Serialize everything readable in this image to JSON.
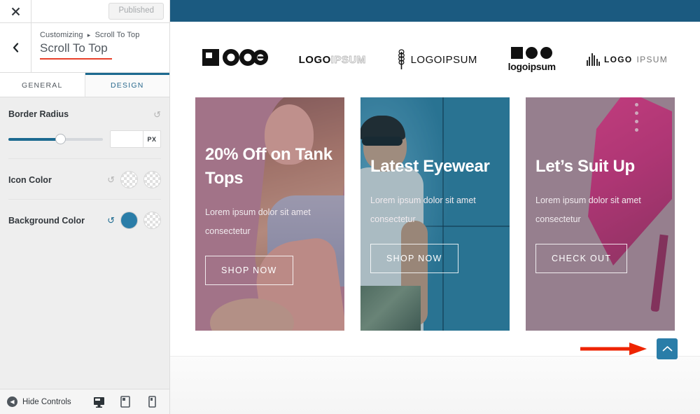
{
  "customizer": {
    "close_icon": "close-icon",
    "publish_button": "Published",
    "back_icon": "chevron-left-icon",
    "breadcrumb_root": "Customizing",
    "breadcrumb_sep": "▸",
    "breadcrumb_current": "Scroll To Top",
    "panel_title": "Scroll To Top",
    "tabs": [
      {
        "label": "GENERAL",
        "active": false
      },
      {
        "label": "DESIGN",
        "active": true
      }
    ],
    "controls": [
      {
        "label": "Border Radius",
        "type": "slider",
        "reset_icon": "reset-icon",
        "reset_active": false,
        "value": "",
        "placeholder": "",
        "unit": "PX",
        "fill_percent": 55
      },
      {
        "label": "Icon Color",
        "type": "color",
        "reset_icon": "reset-icon",
        "reset_active": false,
        "swatches": [
          {
            "name": "icon-color-swatch-primary",
            "kind": "transparent",
            "hex": ""
          },
          {
            "name": "icon-color-swatch-secondary",
            "kind": "transparent",
            "hex": ""
          }
        ]
      },
      {
        "label": "Background Color",
        "type": "color",
        "reset_icon": "reset-icon",
        "reset_active": true,
        "swatches": [
          {
            "name": "bg-color-swatch-primary",
            "kind": "filled",
            "hex": "#2a7da8"
          },
          {
            "name": "bg-color-swatch-secondary",
            "kind": "transparent",
            "hex": ""
          }
        ]
      }
    ],
    "footer": {
      "hide_controls_label": "Hide Controls",
      "hide_controls_icon": "caret-left-circle-icon",
      "devices": [
        {
          "name": "desktop-preview-button",
          "icon": "desktop-icon",
          "active": true
        },
        {
          "name": "tablet-preview-button",
          "icon": "tablet-icon",
          "active": false
        },
        {
          "name": "mobile-preview-button",
          "icon": "mobile-icon",
          "active": false
        }
      ]
    }
  },
  "preview": {
    "topband_color": "#1b5a80",
    "logos": [
      {
        "name": "logo-logo",
        "text": "LOGO"
      },
      {
        "name": "logo-logoipsum-outline",
        "bold": "LOGO",
        "dim": "IPSUM"
      },
      {
        "name": "logo-logoipsum-wheat",
        "text": "LOGOIPSUM"
      },
      {
        "name": "logo-logoipsum-shapes",
        "text": "logoipsum"
      },
      {
        "name": "logo-logoipsum-bars",
        "bold": "LOGO",
        "light": "IPSUM"
      }
    ],
    "cards": [
      {
        "name": "card-tank-tops",
        "title": "20% Off on Tank Tops",
        "subtitle": "Lorem ipsum dolor sit amet consectetur",
        "button": "SHOP NOW",
        "bg_hex": "#ab8092"
      },
      {
        "name": "card-eyewear",
        "title": "Latest Eyewear",
        "subtitle": "Lorem ipsum dolor sit amet consectetur",
        "button": "SHOP NOW",
        "bg_hex": "#2f7e9e"
      },
      {
        "name": "card-suit-up",
        "title": "Let’s Suit Up",
        "subtitle": "Lorem ipsum dolor sit amet consectetur",
        "button": "CHECK OUT",
        "bg_hex": "#9d8794"
      }
    ],
    "scroll_top": {
      "name": "scroll-to-top-button",
      "icon": "chevron-up-icon",
      "bg_hex": "#2a7da8"
    },
    "annotation": {
      "name": "red-arrow-annotation",
      "color_hex": "#ee2400"
    }
  }
}
